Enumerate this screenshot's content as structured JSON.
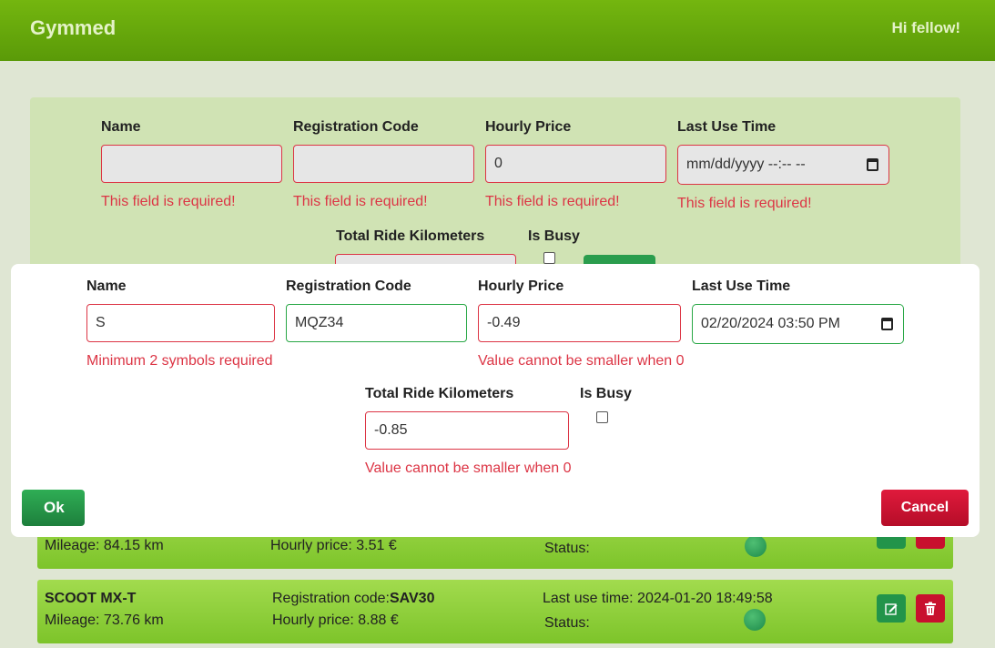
{
  "header": {
    "brand": "Gymmed",
    "greeting": "Hi fellow!"
  },
  "background_form": {
    "fields": [
      {
        "label": "Name",
        "value": "",
        "error": "This field is required!"
      },
      {
        "label": "Registration Code",
        "value": "",
        "error": "This field is required!"
      },
      {
        "label": "Hourly Price",
        "value": "0",
        "error": "This field is required!"
      },
      {
        "label": "Last Use Time",
        "value": "mm/dd/yyyy --:-- --",
        "error": "This field is required!"
      }
    ],
    "total_km_label": "Total Ride Kilometers",
    "is_busy_label": "Is Busy"
  },
  "modal": {
    "name": {
      "label": "Name",
      "value": "S",
      "error": "Minimum 2 symbols required"
    },
    "registration_code": {
      "label": "Registration Code",
      "value": "MQZ34"
    },
    "hourly_price": {
      "label": "Hourly Price",
      "value": "-0.49",
      "error": "Value cannot be smaller when 0"
    },
    "last_use_time": {
      "label": "Last Use Time",
      "value": "02/20/2024 03:50 PM"
    },
    "total_km": {
      "label": "Total Ride Kilometers",
      "value": "-0.85",
      "error": "Value cannot be smaller when 0"
    },
    "is_busy": {
      "label": "Is Busy",
      "checked": false
    },
    "ok_label": "Ok",
    "cancel_label": "Cancel"
  },
  "list": [
    {
      "mileage": "Mileage: 84.15 km",
      "hourly_price": "Hourly price: 3.51 €",
      "status_label": "Status:"
    },
    {
      "name": "SCOOT MX-T",
      "registration_prefix": "Registration code:",
      "registration_code": "SAV30",
      "last_use": "Last use time: 2024-01-20 18:49:58",
      "mileage": "Mileage: 73.76 km",
      "hourly_price": "Hourly price: 8.88 €",
      "status_label": "Status:"
    }
  ],
  "colors": {
    "header": "#6aa90d",
    "valid_border": "#28a745",
    "error": "#dc3545",
    "ok": "#28a745",
    "cancel": "#c8102e"
  },
  "icons": [
    "calendar-icon",
    "edit-icon",
    "trash-icon"
  ]
}
